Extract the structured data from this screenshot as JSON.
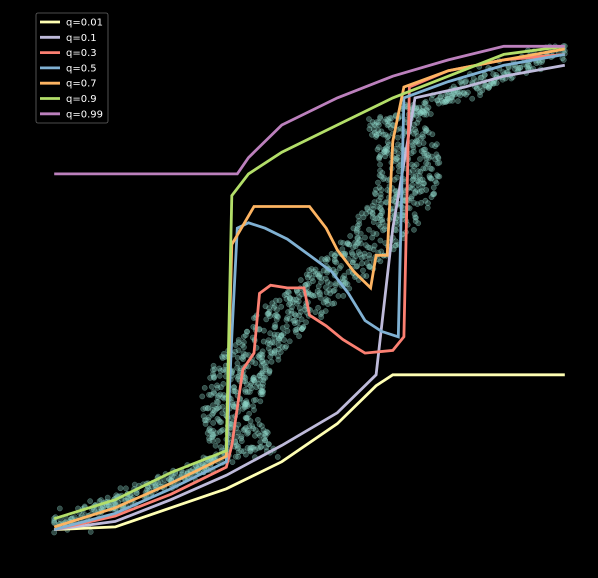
{
  "chart_data": {
    "type": "line",
    "title": "",
    "xlabel": "",
    "ylabel": "",
    "xlim": [
      0,
      10
    ],
    "ylim": [
      0,
      10
    ],
    "grid": false,
    "legend_position": "top-left",
    "background": "#000000",
    "scatter": {
      "color": "#8dd3c7",
      "description": "S-shaped band of data points"
    },
    "series": [
      {
        "name": "q=0.01",
        "color": "#ffffb3",
        "points": [
          [
            0.4,
            0.45
          ],
          [
            1.5,
            0.5
          ],
          [
            2.5,
            0.85
          ],
          [
            3.5,
            1.2
          ],
          [
            4.5,
            1.7
          ],
          [
            5.5,
            2.4
          ],
          [
            6.2,
            3.1
          ],
          [
            6.5,
            3.3
          ],
          [
            7.5,
            3.3
          ],
          [
            9.6,
            3.3
          ]
        ]
      },
      {
        "name": "q=0.1",
        "color": "#bebada",
        "points": [
          [
            0.4,
            0.45
          ],
          [
            1.5,
            0.6
          ],
          [
            2.5,
            1.0
          ],
          [
            3.5,
            1.45
          ],
          [
            4.5,
            2.0
          ],
          [
            5.5,
            2.6
          ],
          [
            6.2,
            3.3
          ],
          [
            6.5,
            6.0
          ],
          [
            6.9,
            8.4
          ],
          [
            7.8,
            8.6
          ],
          [
            8.5,
            8.8
          ],
          [
            9.6,
            9.0
          ]
        ]
      },
      {
        "name": "q=0.3",
        "color": "#fb8072",
        "points": [
          [
            0.4,
            0.45
          ],
          [
            1.5,
            0.7
          ],
          [
            2.5,
            1.1
          ],
          [
            3.5,
            1.6
          ],
          [
            3.6,
            2.0
          ],
          [
            3.8,
            3.4
          ],
          [
            4.0,
            3.7
          ],
          [
            4.1,
            4.8
          ],
          [
            4.3,
            4.95
          ],
          [
            4.6,
            4.9
          ],
          [
            4.9,
            4.9
          ],
          [
            5.0,
            4.4
          ],
          [
            5.3,
            4.2
          ],
          [
            5.6,
            3.95
          ],
          [
            6.0,
            3.7
          ],
          [
            6.5,
            3.75
          ],
          [
            6.7,
            4.0
          ],
          [
            6.8,
            8.6
          ],
          [
            7.5,
            8.9
          ],
          [
            8.5,
            9.1
          ],
          [
            9.6,
            9.2
          ]
        ]
      },
      {
        "name": "q=0.5",
        "color": "#80b1d3",
        "points": [
          [
            0.4,
            0.45
          ],
          [
            1.5,
            0.75
          ],
          [
            2.5,
            1.2
          ],
          [
            3.5,
            1.7
          ],
          [
            3.6,
            4.0
          ],
          [
            3.7,
            6.0
          ],
          [
            3.9,
            6.1
          ],
          [
            4.2,
            6.0
          ],
          [
            4.6,
            5.8
          ],
          [
            5.0,
            5.5
          ],
          [
            5.4,
            5.2
          ],
          [
            5.7,
            4.8
          ],
          [
            6.0,
            4.3
          ],
          [
            6.3,
            4.1
          ],
          [
            6.6,
            4.0
          ],
          [
            6.7,
            8.4
          ],
          [
            7.5,
            8.7
          ],
          [
            8.5,
            9.0
          ],
          [
            9.6,
            9.2
          ]
        ]
      },
      {
        "name": "q=0.7",
        "color": "#fdb462",
        "points": [
          [
            0.4,
            0.5
          ],
          [
            1.5,
            0.85
          ],
          [
            2.5,
            1.3
          ],
          [
            3.5,
            1.8
          ],
          [
            3.6,
            5.7
          ],
          [
            4.0,
            6.4
          ],
          [
            4.5,
            6.4
          ],
          [
            5.0,
            6.4
          ],
          [
            5.3,
            6.0
          ],
          [
            5.5,
            5.6
          ],
          [
            5.8,
            5.2
          ],
          [
            6.1,
            4.9
          ],
          [
            6.2,
            5.5
          ],
          [
            6.4,
            5.5
          ],
          [
            6.5,
            7.6
          ],
          [
            6.7,
            8.6
          ],
          [
            7.5,
            8.9
          ],
          [
            8.5,
            9.1
          ],
          [
            9.6,
            9.3
          ]
        ]
      },
      {
        "name": "q=0.9",
        "color": "#b3de69",
        "points": [
          [
            0.4,
            0.65
          ],
          [
            1.5,
            1.0
          ],
          [
            2.5,
            1.5
          ],
          [
            3.5,
            1.9
          ],
          [
            3.6,
            6.6
          ],
          [
            3.9,
            7.0
          ],
          [
            4.5,
            7.4
          ],
          [
            5.5,
            7.9
          ],
          [
            6.5,
            8.4
          ],
          [
            7.5,
            8.8
          ],
          [
            8.5,
            9.2
          ],
          [
            9.6,
            9.35
          ]
        ]
      },
      {
        "name": "q=0.99",
        "color": "#bc80bd",
        "points": [
          [
            0.4,
            7.0
          ],
          [
            3.7,
            7.0
          ],
          [
            3.9,
            7.3
          ],
          [
            4.5,
            7.9
          ],
          [
            5.5,
            8.4
          ],
          [
            6.5,
            8.8
          ],
          [
            7.5,
            9.1
          ],
          [
            8.5,
            9.35
          ],
          [
            9.6,
            9.35
          ]
        ]
      }
    ]
  }
}
